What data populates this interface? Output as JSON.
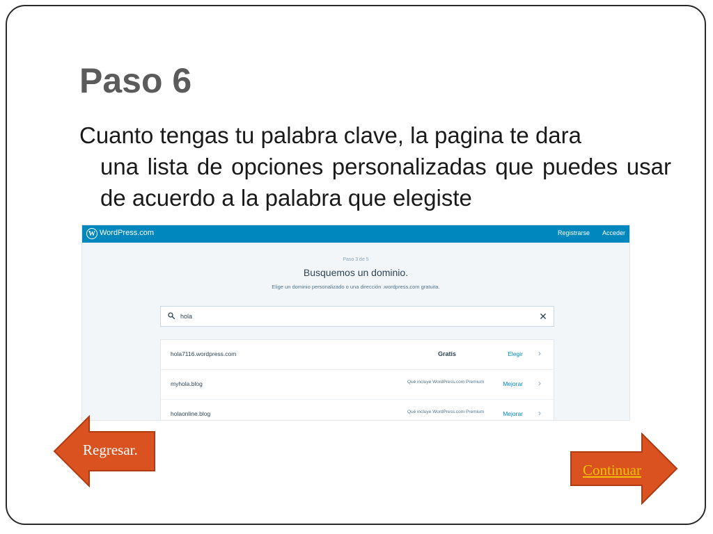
{
  "slide": {
    "title": "Paso 6",
    "body_line1": "Cuanto tengas tu palabra clave, la pagina te dara",
    "body_rest": "una lista de opciones personalizadas que puedes usar de acuerdo a la palabra que elegiste"
  },
  "wordpress": {
    "brand": "WordPress.com",
    "logo_letter": "W",
    "nav": {
      "signup": "Registrarse",
      "login": "Acceder"
    },
    "step": "Paso 3 de 5",
    "heading": "Busquemos un dominio.",
    "subheading": "Elige un dominio personalizado o una dirección .wordpress.com gratuita.",
    "search": {
      "value": "hola",
      "clear_icon": "close-icon"
    },
    "results": [
      {
        "domain": "hola7116.wordpress.com",
        "price": "Gratis",
        "note": "",
        "action": "Elegir"
      },
      {
        "domain": "myhola.blog",
        "price": "",
        "note": "Qué incluye WordPress.com Premium",
        "action": "Mejorar"
      },
      {
        "domain": "holaonline.blog",
        "price": "",
        "note": "Qué incluye WordPress.com Premium",
        "action": "Mejorar"
      }
    ]
  },
  "navigation": {
    "back_label": "Regresar.",
    "forward_label": "Continuar"
  },
  "colors": {
    "wp_blue": "#0087be",
    "arrow_fill": "#d9521f",
    "arrow_stroke": "#b03a12",
    "forward_label": "#f2c200",
    "title_gray": "#5b5b5b"
  }
}
